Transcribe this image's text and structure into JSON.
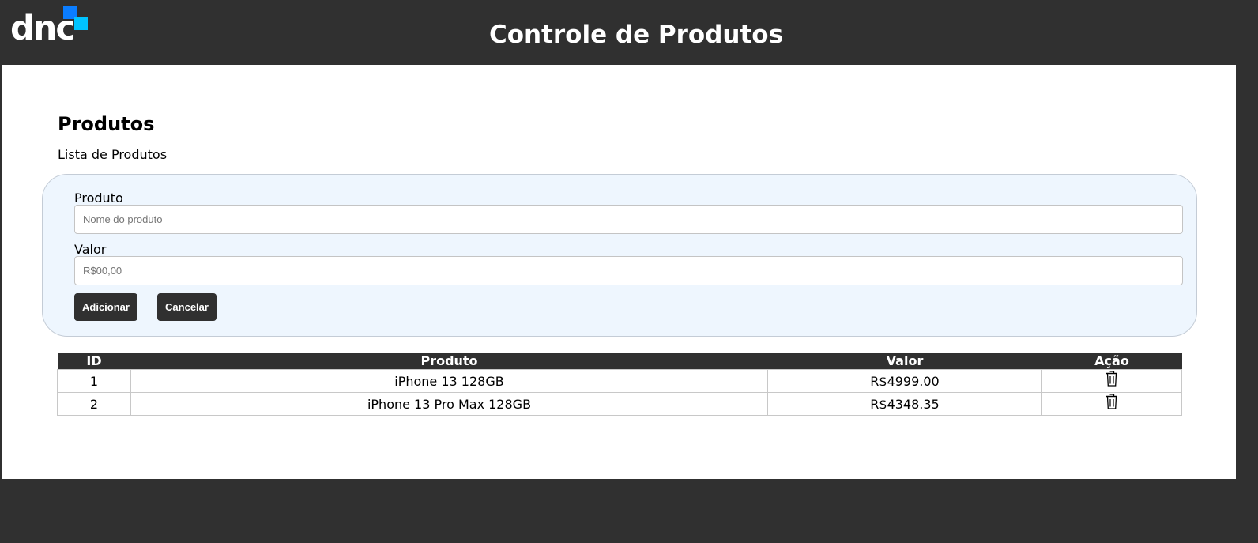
{
  "header": {
    "logo_text": "dnc",
    "title": "Controle de Produtos"
  },
  "page": {
    "title": "Produtos",
    "subtitle": "Lista de Produtos"
  },
  "form": {
    "product_label": "Produto",
    "product_placeholder": "Nome do produto",
    "product_value": "",
    "value_label": "Valor",
    "value_placeholder": "R$00,00",
    "value_value": "",
    "add_button": "Adicionar",
    "cancel_button": "Cancelar"
  },
  "table": {
    "headers": {
      "id": "ID",
      "product": "Produto",
      "value": "Valor",
      "action": "Ação"
    },
    "rows": [
      {
        "id": "1",
        "product": "iPhone 13 128GB",
        "value": "R$4999.00",
        "action_icon": "trash-icon"
      },
      {
        "id": "2",
        "product": "iPhone 13 Pro Max 128GB",
        "value": "R$4348.35",
        "action_icon": "trash-icon"
      }
    ]
  },
  "colors": {
    "dark": "#303030",
    "logo_blue": "#0b7dff",
    "logo_cyan": "#00c3ff",
    "card_bg": "#eef6fe"
  }
}
